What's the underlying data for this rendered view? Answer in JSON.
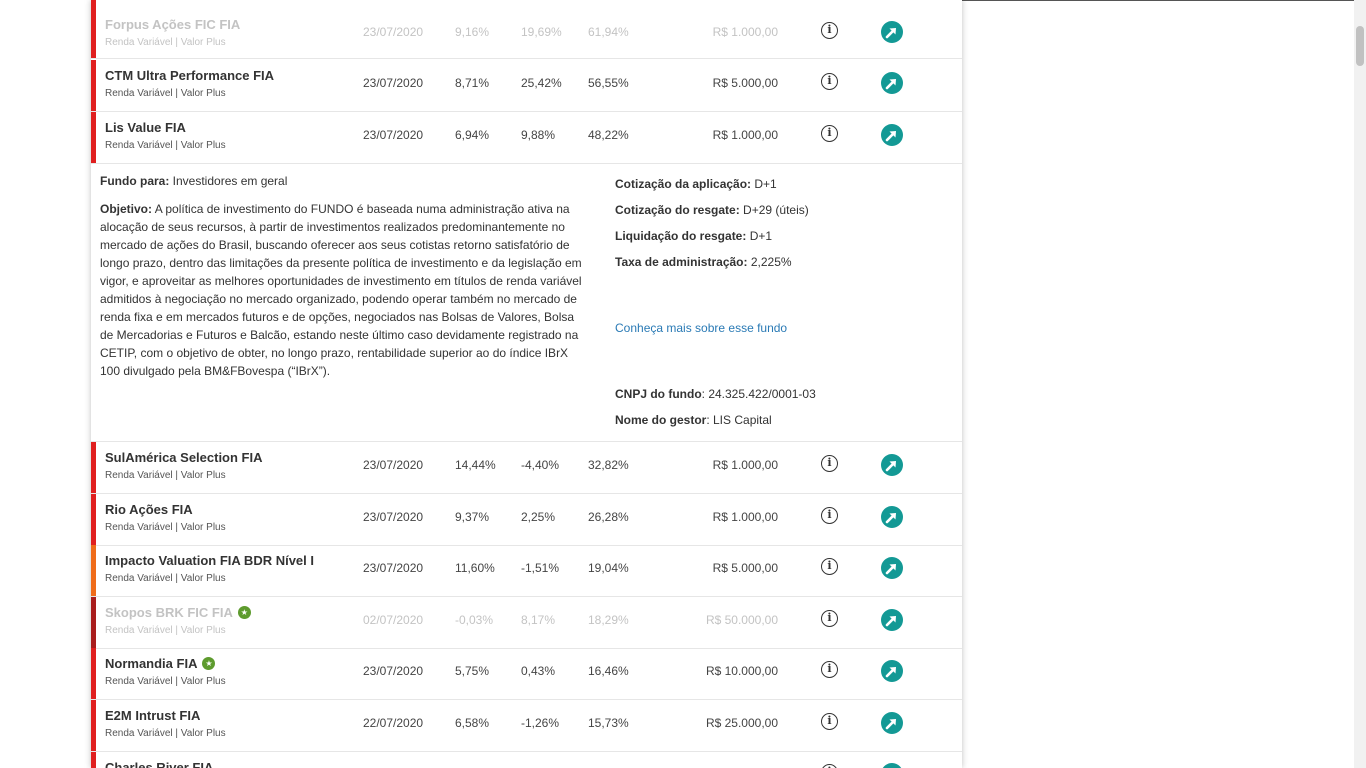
{
  "funds": [
    {
      "name": "Forpus Ações FIC FIA",
      "category": "Renda Variável | Valor Plus",
      "date": "23/07/2020",
      "month": "9,16%",
      "year": "19,69%",
      "twelve": "61,94%",
      "min": "R$ 1.000,00",
      "stripe": "#e01f1f",
      "dim": true,
      "star": false
    },
    {
      "name": "CTM Ultra Performance FIA",
      "category": "Renda Variável | Valor Plus",
      "date": "23/07/2020",
      "month": "8,71%",
      "year": "25,42%",
      "twelve": "56,55%",
      "min": "R$ 5.000,00",
      "stripe": "#e01f1f",
      "dim": false,
      "star": false
    },
    {
      "name": "Lis Value FIA",
      "category": "Renda Variável | Valor Plus",
      "date": "23/07/2020",
      "month": "6,94%",
      "year": "9,88%",
      "twelve": "48,22%",
      "min": "R$ 1.000,00",
      "stripe": "#e01f1f",
      "dim": false,
      "star": false
    },
    {
      "name": "SulAmérica Selection FIA",
      "category": "Renda Variável | Valor Plus",
      "date": "23/07/2020",
      "month": "14,44%",
      "year": "-4,40%",
      "twelve": "32,82%",
      "min": "R$ 1.000,00",
      "stripe": "#e01f1f",
      "dim": false,
      "star": false
    },
    {
      "name": "Rio Ações FIA",
      "category": "Renda Variável | Valor Plus",
      "date": "23/07/2020",
      "month": "9,37%",
      "year": "2,25%",
      "twelve": "26,28%",
      "min": "R$ 1.000,00",
      "stripe": "#e01f1f",
      "dim": false,
      "star": false
    },
    {
      "name": "Impacto Valuation FIA BDR Nível I",
      "category": "Renda Variável | Valor Plus",
      "date": "23/07/2020",
      "month": "11,60%",
      "year": "-1,51%",
      "twelve": "19,04%",
      "min": "R$ 5.000,00",
      "stripe": "#ef6c1a",
      "dim": false,
      "star": false
    },
    {
      "name": "Skopos BRK FIC FIA",
      "category": "Renda Variável | Valor Plus",
      "date": "02/07/2020",
      "month": "-0,03%",
      "year": "8,17%",
      "twelve": "18,29%",
      "min": "R$ 50.000,00",
      "stripe": "#a91d1d",
      "dim": true,
      "star": true
    },
    {
      "name": "Normandia FIA",
      "category": "Renda Variável | Valor Plus",
      "date": "23/07/2020",
      "month": "5,75%",
      "year": "0,43%",
      "twelve": "16,46%",
      "min": "R$ 10.000,00",
      "stripe": "#e01f1f",
      "dim": false,
      "star": true
    },
    {
      "name": "E2M Intrust FIA",
      "category": "Renda Variável | Valor Plus",
      "date": "22/07/2020",
      "month": "6,58%",
      "year": "-1,26%",
      "twelve": "15,73%",
      "min": "R$ 25.000,00",
      "stripe": "#e01f1f",
      "dim": false,
      "star": false
    },
    {
      "name": "Charles River FIA",
      "category": "",
      "date": "",
      "month": "",
      "year": "",
      "twelve": "",
      "min": "",
      "stripe": "#e01f1f",
      "dim": false,
      "star": false
    }
  ],
  "detail": {
    "fundo_para_label": "Fundo para:",
    "fundo_para_value": " Investidores em geral",
    "objetivo_label": "Objetivo:",
    "objetivo_value": " A política de investimento do FUNDO é baseada numa administração ativa na alocação de seus recursos, à partir de investimentos realizados predominantemente no mercado de ações do Brasil, buscando oferecer aos seus cotistas retorno satisfatório de longo prazo, dentro das limitações da presente política de investimento e da legislação em vigor, e aproveitar as melhores oportunidades de investimento em títulos de renda variável admitidos à negociação no mercado organizado, podendo operar também no mercado de renda fixa e em mercados futuros e de opções, negociados nas Bolsas de Valores, Bolsa de Mercadorias e Futuros e Balcão, estando neste último caso devidamente registrado na CETIP, com o objetivo de obter, no longo prazo, rentabilidade superior ao do índice IBrX 100 divulgado pela BM&FBovespa (“IBrX”).",
    "cot_aplic_label": "Cotização da aplicação:",
    "cot_aplic_value": " D+1",
    "cot_resg_label": "Cotização do resgate:",
    "cot_resg_value": " D+29 (úteis)",
    "liq_resg_label": "Liquidação do resgate:",
    "liq_resg_value": " D+1",
    "taxa_label": "Taxa de administração:",
    "taxa_value": " 2,225%",
    "link": "Conheça mais sobre esse fundo",
    "cnpj_label": "CNPJ do fundo",
    "cnpj_value": ": 24.325.422/0001-03",
    "gestor_label": "Nome do gestor",
    "gestor_value": ": LIS Capital"
  },
  "icons": {
    "info": "info-icon",
    "go": "arrow-up-right-icon"
  },
  "colors": {
    "accent": "#139995",
    "link": "#2a7ab5",
    "star": "#5e9b2e"
  }
}
